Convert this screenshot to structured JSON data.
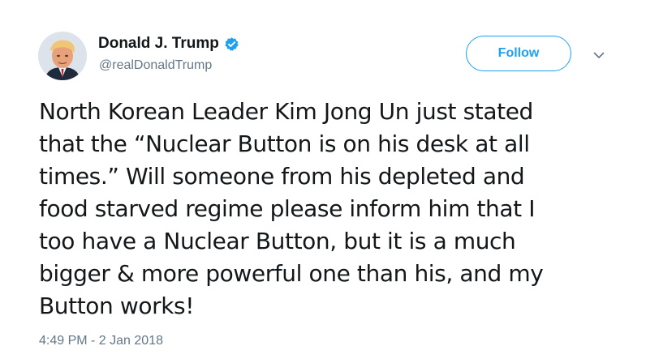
{
  "author": {
    "display_name": "Donald J. Trump",
    "handle": "@realDonaldTrump",
    "verified": true
  },
  "actions": {
    "follow_label": "Follow",
    "more_icon": "chevron-down-icon"
  },
  "tweet": {
    "lines": [
      "North Korean Leader Kim Jong Un just stated",
      "that the “Nuclear Button is on his desk at all",
      "times.” Will someone from his depleted and",
      "food starved regime please inform him that I",
      "too have a Nuclear Button, but it is a much",
      "bigger & more powerful one than his, and my",
      "Button works!"
    ],
    "timestamp": "4:49 PM - 2 Jan 2018"
  },
  "colors": {
    "accent": "#1da1f2",
    "text": "#14171a",
    "muted": "#657786"
  }
}
